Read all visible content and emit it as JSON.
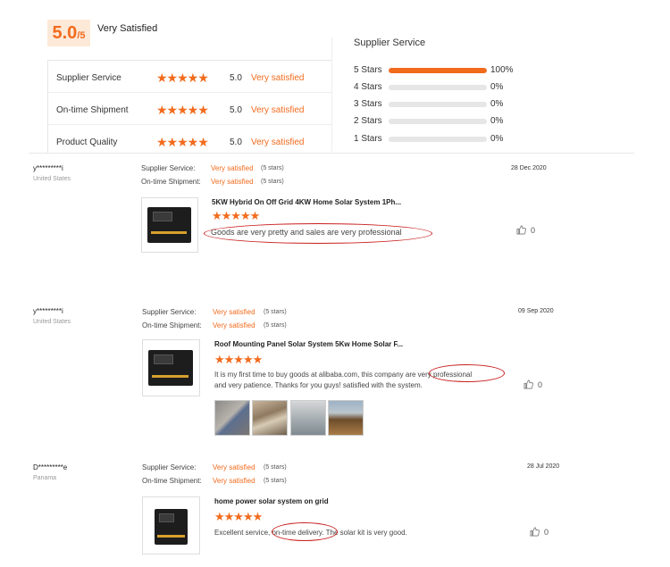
{
  "summary": {
    "score": "5.0",
    "score_denominator": "/5",
    "score_label": "Very Satisfied",
    "rows": [
      {
        "label": "Supplier Service",
        "stars": 5,
        "num": "5.0",
        "text": "Very satisfied"
      },
      {
        "label": "On-time Shipment",
        "stars": 5,
        "num": "5.0",
        "text": "Very satisfied"
      },
      {
        "label": "Product Quality",
        "stars": 5,
        "num": "5.0",
        "text": "Very satisfied"
      }
    ]
  },
  "distribution": {
    "title": "Supplier Service",
    "rows": [
      {
        "label": "5 Stars",
        "fraction": 1.0,
        "pct": "100%"
      },
      {
        "label": "4 Stars",
        "fraction": 0.0,
        "pct": "0%"
      },
      {
        "label": "3 Stars",
        "fraction": 0.0,
        "pct": "0%"
      },
      {
        "label": "2 Stars",
        "fraction": 0.0,
        "pct": "0%"
      },
      {
        "label": "1 Stars",
        "fraction": 0.0,
        "pct": "0%"
      }
    ]
  },
  "star_glyph": "★★★★★",
  "reviews": [
    {
      "name": "y*********i",
      "country": "United States",
      "supplier_label": "Supplier Service:",
      "supplier_value": "Very satisfied",
      "supplier_stars": "(5 stars)",
      "shipment_label": "On-time Shipment:",
      "shipment_value": "Very satisfied",
      "shipment_stars": "(5 stars)",
      "date": "28 Dec 2020",
      "product_title": "5KW Hybrid On Off Grid 4KW Home Solar System 1Ph...",
      "rating": 5,
      "comment": "Goods are very pretty and sales are very professional",
      "likes": "0"
    },
    {
      "name": "y*********i",
      "country": "United States",
      "supplier_label": "Supplier Service:",
      "supplier_value": "Very satisfied",
      "supplier_stars": "(5 stars)",
      "shipment_label": "On-time Shipment:",
      "shipment_value": "Very satisfied",
      "shipment_stars": "(5 stars)",
      "date": "09 Sep 2020",
      "product_title": "Roof Mounting Panel Solar System 5Kw Home Solar F...",
      "rating": 5,
      "comment_line1": "It is my first time to buy goods at alibaba.com, this company are very professional",
      "comment_line2": "and very patience. Thanks for you guys! satisfied with the system.",
      "likes": "0"
    },
    {
      "name": "D*********e",
      "country": "Panama",
      "supplier_label": "Supplier Service:",
      "supplier_value": "Very satisfied",
      "supplier_stars": "(5 stars)",
      "shipment_label": "On-time Shipment:",
      "shipment_value": "Very satisfied",
      "shipment_stars": "(5 stars)",
      "date": "28 Jul 2020",
      "product_title": "home power solar system on grid",
      "rating": 5,
      "comment": "Excellent service, on-time delivery. The solar kit is very good.",
      "likes": "0"
    }
  ],
  "colors": {
    "accent": "#f26b1d",
    "highlight": "#c81e1e"
  }
}
